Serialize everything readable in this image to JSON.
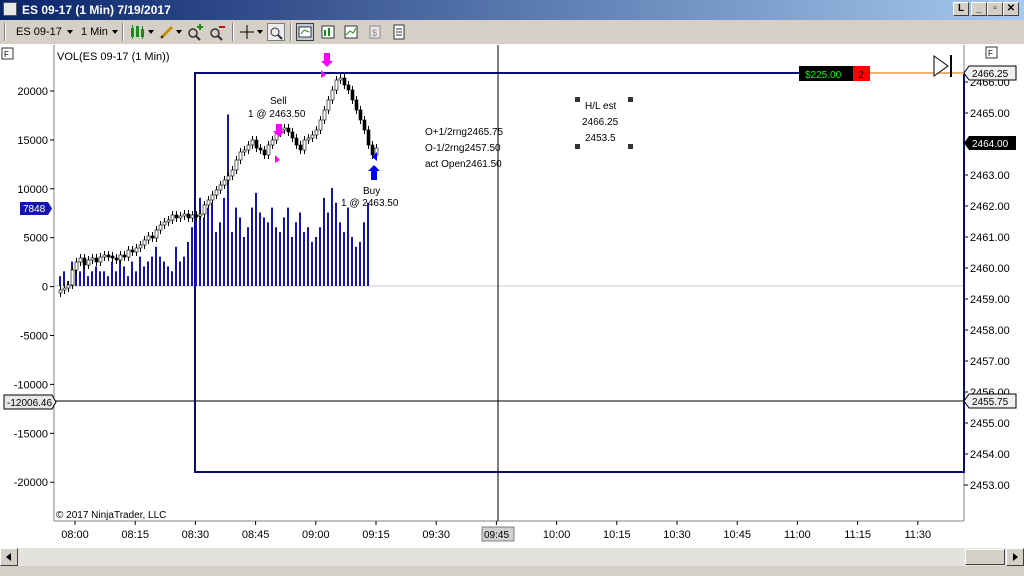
{
  "window": {
    "title": "ES 09-17 (1 Min)  7/19/2017"
  },
  "toolbar": {
    "instrument": "ES 09-17",
    "interval": "1 Min"
  },
  "chart": {
    "panel_title": "VOL(ES 09-17 (1 Min))",
    "copyright": "© 2017 NinjaTrader, LLC",
    "volume_axis_labels": [
      "20000",
      "15000",
      "10000",
      "5000",
      "0",
      "-5000",
      "-10000",
      "-15000",
      "-20000"
    ],
    "price_axis_labels": [
      "2466.00",
      "2465.00",
      "2464.00",
      "2463.00",
      "2462.00",
      "2461.00",
      "2460.00",
      "2459.00",
      "2458.00",
      "2457.00",
      "2456.00",
      "2455.00",
      "2454.00",
      "2453.00"
    ],
    "time_axis_labels": [
      "08:00",
      "08:15",
      "08:30",
      "08:45",
      "09:00",
      "09:15",
      "09:30",
      "09:45",
      "10:00",
      "10:15",
      "10:30",
      "10:45",
      "11:00",
      "11:15",
      "11:30"
    ],
    "crosshair_time": "09:45",
    "volume_marker": "7848",
    "crosshair_volume": "-12006.46",
    "price_marker_top": "2466.25",
    "price_marker_mid": "2464.00",
    "price_marker_cross": "2455.75",
    "position_pnl": "$225.00",
    "position_qty": "2",
    "sell_label": "Sell",
    "sell_detail": "1 @ 2463.50",
    "buy_label": "Buy",
    "buy_detail": "1 @ 2463.50",
    "annotation_lines": [
      "O+1/2rng2465.75",
      "O-1/2rng2457.50",
      "act Open2461.50"
    ],
    "hl_box": {
      "title": "H/L est",
      "high": "2466.25",
      "low": "2453.5"
    }
  },
  "colors": {
    "volume": "#1414b4",
    "pnl_bg": "#000000",
    "pnl_text": "#00ff00",
    "qty_bg": "#ff0000",
    "rect": "#0a0a78",
    "sell_marker": "#ff00ff",
    "buy_marker": "#0000ff"
  }
}
